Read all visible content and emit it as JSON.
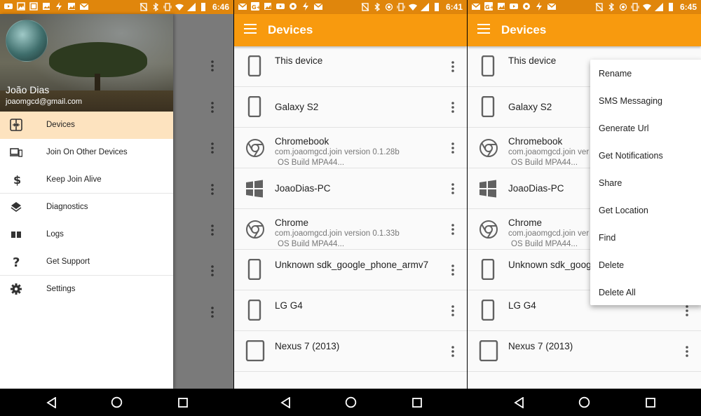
{
  "status": {
    "time_left": "6:46",
    "time_middle": "6:41",
    "time_right": "6:45"
  },
  "colors": {
    "accent": "#f89a0e",
    "status_bar": "#e0860c",
    "selected": "#fde3bf",
    "icon": "#616161"
  },
  "appbar": {
    "title": "Devices"
  },
  "drawer": {
    "user_name": "João Dias",
    "user_email": "joaomgcd@gmail.com",
    "items": [
      {
        "label": "Devices",
        "icon": "devices-icon"
      },
      {
        "label": "Join On Other Devices",
        "icon": "devices-link-icon"
      },
      {
        "label": "Keep Join Alive",
        "icon": "dollar-icon"
      },
      {
        "label": "Diagnostics",
        "icon": "layers-icon"
      },
      {
        "label": "Logs",
        "icon": "book-icon"
      },
      {
        "label": "Get Support",
        "icon": "help-icon"
      },
      {
        "label": "Settings",
        "icon": "gear-icon"
      }
    ]
  },
  "devices": [
    {
      "name": "This device",
      "icon": "phone-icon"
    },
    {
      "name": "Galaxy S2",
      "icon": "phone-icon"
    },
    {
      "name": "Chromebook",
      "sub1": "com.joaomgcd.join version 0.1.28b",
      "sub2": "OS Build MPA44...",
      "icon": "chrome-icon"
    },
    {
      "name": "JoaoDias-PC",
      "icon": "windows-icon"
    },
    {
      "name": "Chrome",
      "sub1": "com.joaomgcd.join version 0.1.33b",
      "sub2": "OS Build MPA44...",
      "icon": "chrome-icon"
    },
    {
      "name": "Unknown sdk_google_phone_armv7",
      "icon": "phone-icon"
    },
    {
      "name": "LG G4",
      "icon": "phone-icon"
    },
    {
      "name": "Nexus 7 (2013)",
      "icon": "tablet-icon"
    }
  ],
  "devices_truncated": {
    "chromebook_sub1": "com.joaomgcd.join ver",
    "chrome_sub1": "com.joaomgcd.join ver",
    "unknown_name": "Unknown sdk_googl"
  },
  "popup_menu": [
    "Rename",
    "SMS Messaging",
    "Generate Url",
    "Get Notifications",
    "Share",
    "Get Location",
    "Find",
    "Delete",
    "Delete All"
  ]
}
